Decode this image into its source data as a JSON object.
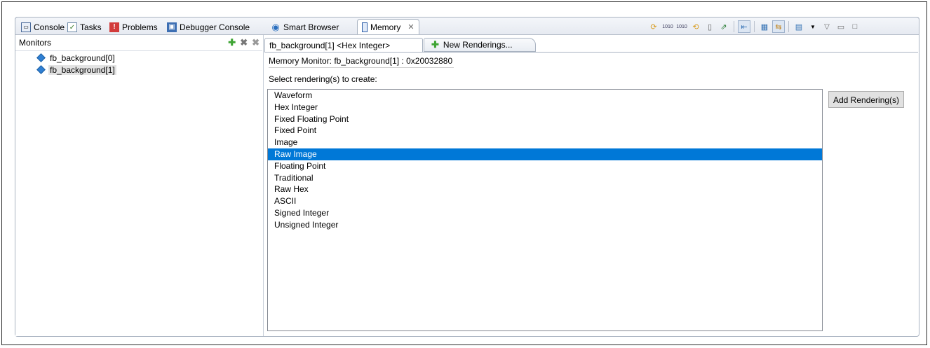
{
  "tabs": [
    {
      "label": "Console",
      "icon": "console-icon"
    },
    {
      "label": "Tasks",
      "icon": "tasks-icon"
    },
    {
      "label": "Problems",
      "icon": "problems-icon"
    },
    {
      "label": "Debugger Console",
      "icon": "debugger-console-icon"
    },
    {
      "label": "Smart Browser",
      "icon": "smart-browser-icon"
    },
    {
      "label": "Memory",
      "icon": "memory-icon",
      "active": true
    }
  ],
  "toolbar_icons": [
    "refresh-icon",
    "binary-import-icon",
    "binary-export-icon",
    "link-icon",
    "new-icon",
    "export-icon",
    "sync-icon",
    "layout-icon",
    "toggle-icon",
    "grid-icon",
    "view-menu-icon",
    "minimize-icon",
    "maximize-icon"
  ],
  "monitors": {
    "title": "Monitors",
    "items": [
      {
        "label": "fb_background[0]"
      },
      {
        "label": "fb_background[1]",
        "selected": true
      }
    ]
  },
  "renderings": {
    "tab_active": "fb_background[1] <Hex Integer>",
    "tab_new": "New Renderings..."
  },
  "panel": {
    "memory_monitor": "Memory Monitor: fb_background[1] : 0x20032880",
    "select_label": "Select rendering(s) to create:",
    "options": [
      "Waveform",
      "Hex Integer",
      "Fixed Floating Point",
      "Fixed Point",
      "Image",
      "Raw Image",
      "Floating Point",
      "Traditional",
      "Raw Hex",
      "ASCII",
      "Signed Integer",
      "Unsigned Integer"
    ],
    "selected_option": "Raw Image",
    "add_button": "Add Rendering(s)"
  },
  "colors": {
    "selection": "#0078d7",
    "accent_green": "#3fa535"
  }
}
